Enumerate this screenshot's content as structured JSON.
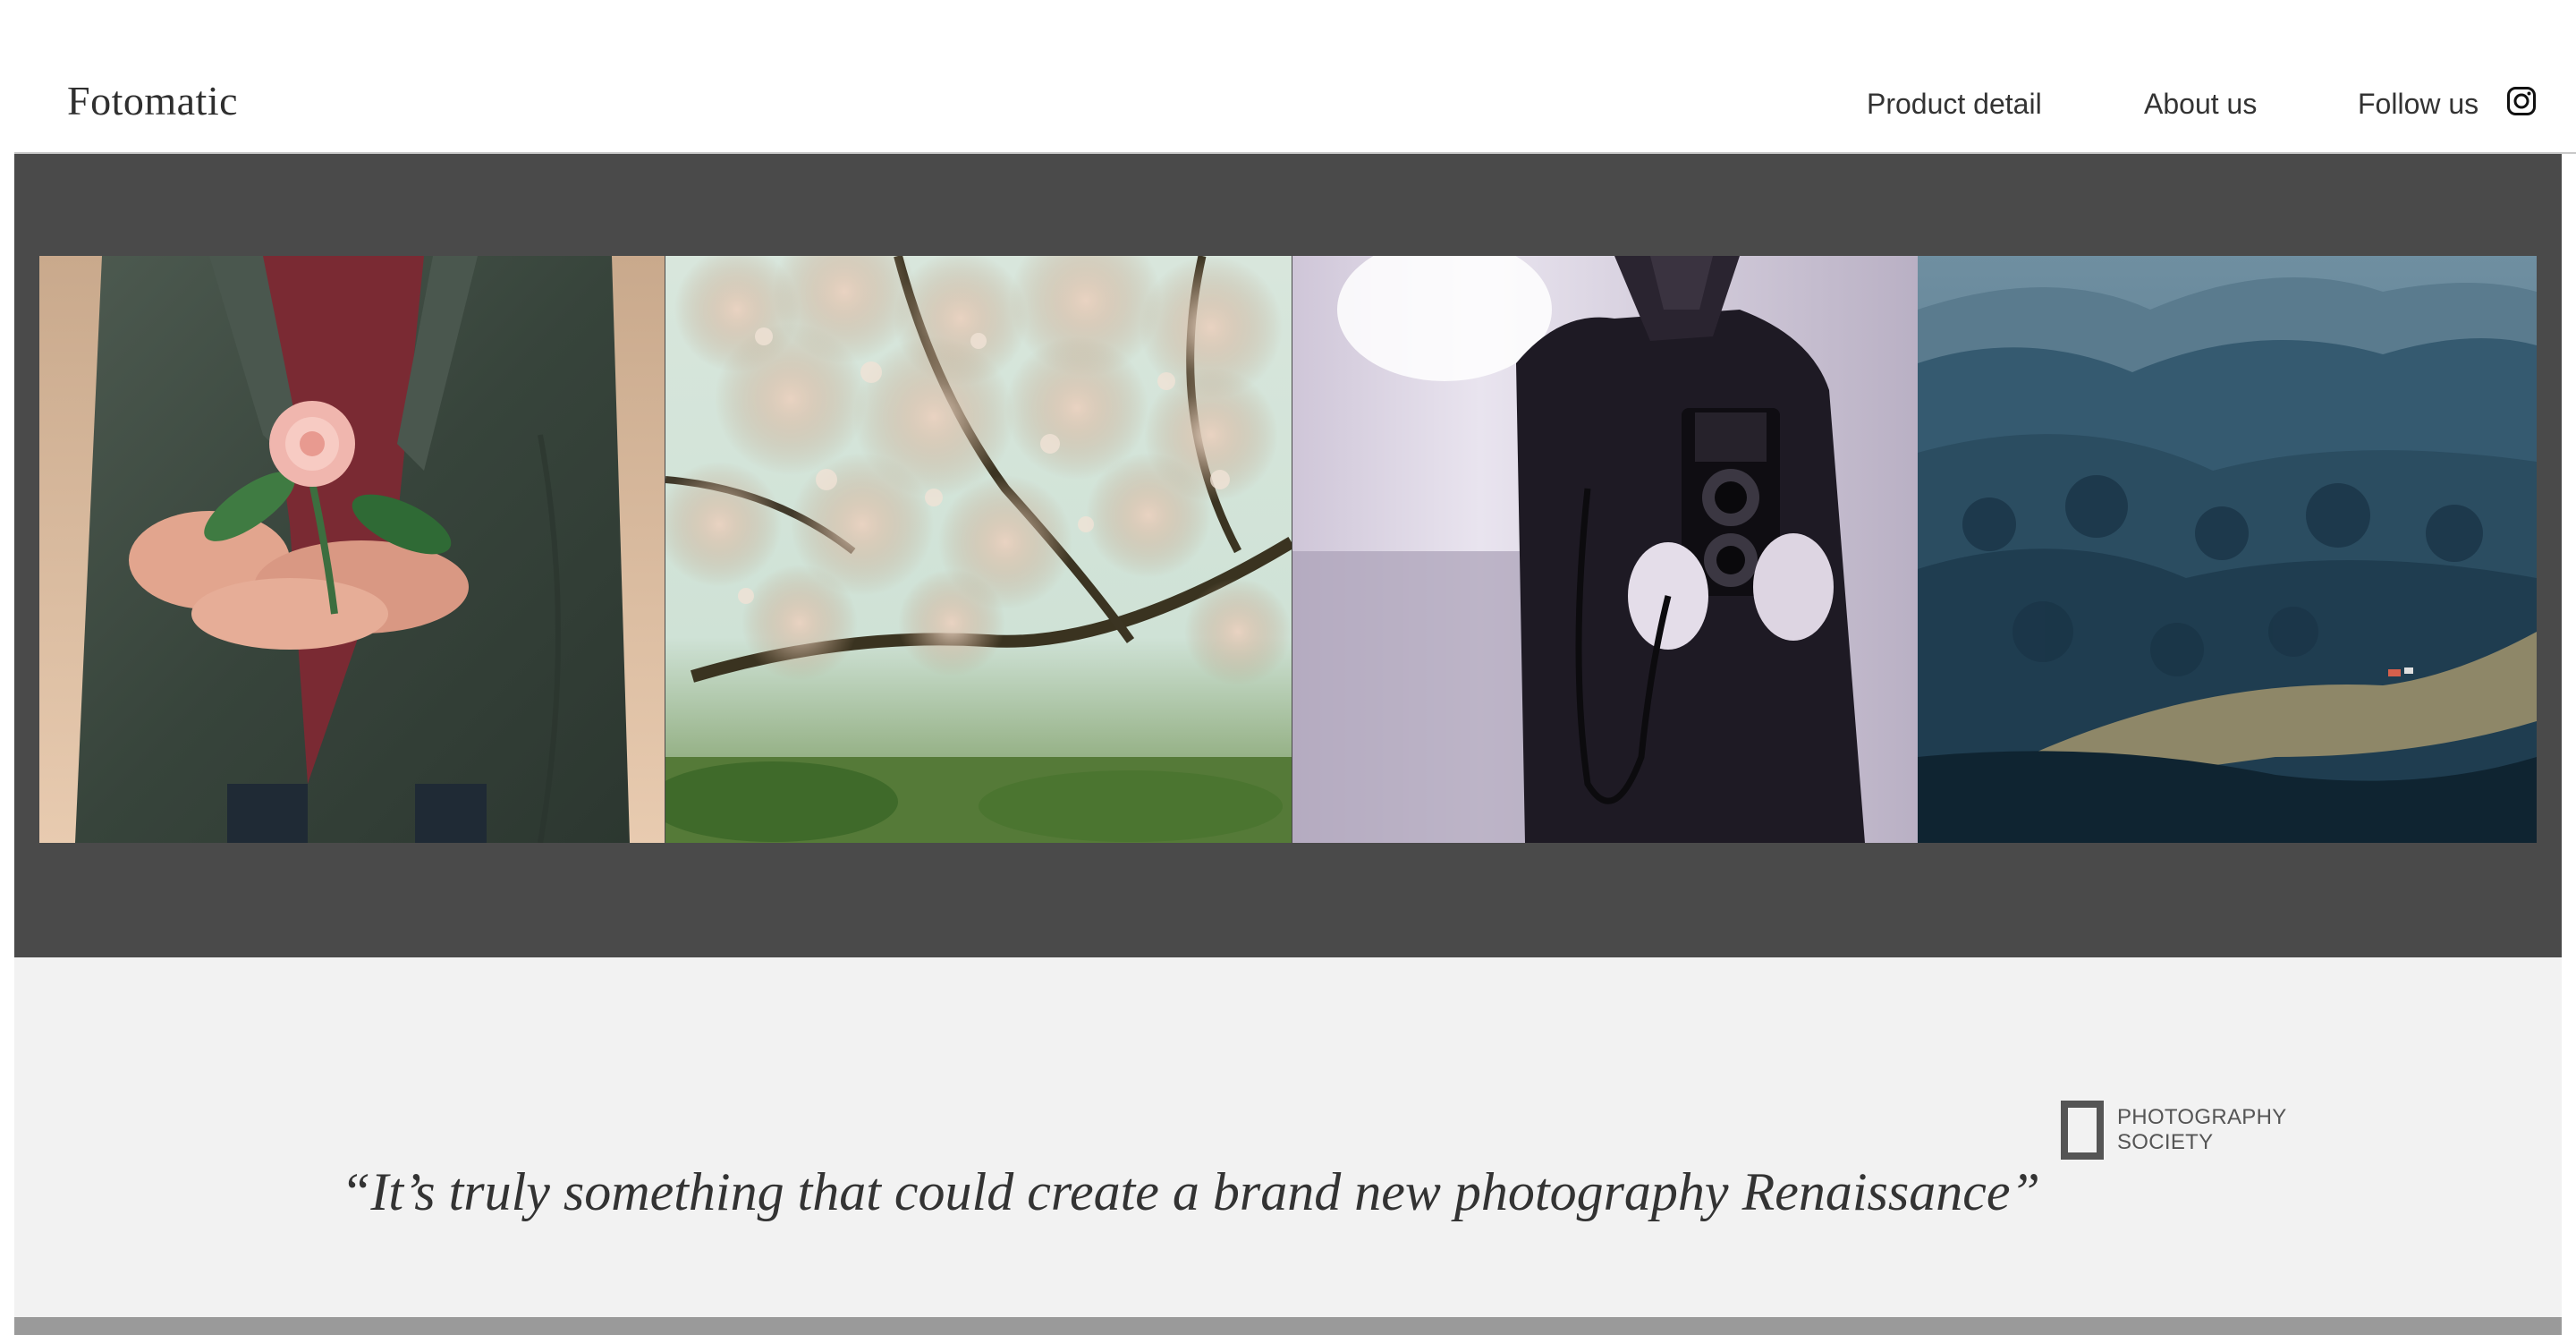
{
  "header": {
    "brand": "Fotomatic",
    "nav": {
      "product_detail": "Product detail",
      "about_us": "About us",
      "follow_us": "Follow us"
    },
    "social_icon": "instagram-icon"
  },
  "gallery": {
    "photos": [
      {
        "subject": "person holding a pink rose"
      },
      {
        "subject": "blossoming magnolia tree"
      },
      {
        "subject": "man holding a twin-lens camera"
      },
      {
        "subject": "forested mountain valley"
      }
    ]
  },
  "testimonial": {
    "quote": "“It’s truly something that could create a brand new photography Renaissance”",
    "source_line1": "PHOTOGRAPHY",
    "source_line2": "SOCIETY",
    "source_icon": "photography-society-logo-icon"
  },
  "colors": {
    "gallery_bg": "#4a4a4a",
    "quote_bg": "#f2f2f2",
    "text": "#333333",
    "footer": "#9a9a9a"
  }
}
